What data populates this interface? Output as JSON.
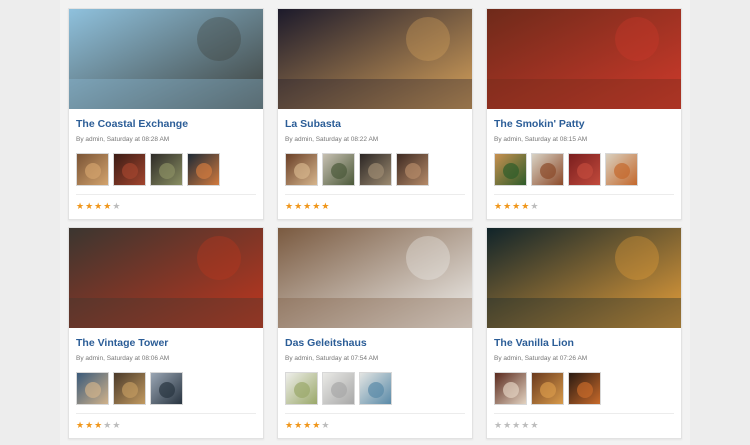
{
  "restaurants": [
    {
      "name": "The Coastal Exchange",
      "meta": "By admin, Saturday at 08:28 AM",
      "rating": 4,
      "hero_colors": [
        "#8fc1dd",
        "#3c3f3a"
      ],
      "thumbs": [
        [
          "#7a5436",
          "#d3a36c"
        ],
        [
          "#3c1c15",
          "#a2452e"
        ],
        [
          "#2e2b28",
          "#8a8f62"
        ],
        [
          "#1d2a36",
          "#d27a3e"
        ]
      ]
    },
    {
      "name": "La Subasta",
      "meta": "By admin, Saturday at 08:22 AM",
      "rating": 5,
      "hero_colors": [
        "#1c1a2b",
        "#d8a35b"
      ],
      "thumbs": [
        [
          "#6a4028",
          "#d6b58c"
        ],
        [
          "#c7c0b2",
          "#4c5a3a"
        ],
        [
          "#2b2624",
          "#9c8a70"
        ],
        [
          "#3e2a22",
          "#b58a68"
        ]
      ]
    },
    {
      "name": "The Smokin' Patty",
      "meta": "By admin, Saturday at 08:15 AM",
      "rating": 4,
      "hero_colors": [
        "#6e2a1a",
        "#cf3a2b"
      ],
      "thumbs": [
        [
          "#c79050",
          "#2e5c2a"
        ],
        [
          "#d8d2c4",
          "#8c4a2a"
        ],
        [
          "#7a1e1e",
          "#c24a3c"
        ],
        [
          "#d9d0bf",
          "#c4682c"
        ]
      ]
    },
    {
      "name": "The Vintage Tower",
      "meta": "By admin, Saturday at 08:06 AM",
      "rating": 3,
      "hero_colors": [
        "#3b3630",
        "#c0361e"
      ],
      "thumbs": [
        [
          "#3a5a7a",
          "#d0b28a"
        ],
        [
          "#4a3a2a",
          "#c29a60"
        ],
        [
          "#9aa6b4",
          "#283440"
        ]
      ]
    },
    {
      "name": "Das Geleitshaus",
      "meta": "By admin, Saturday at 07:54 AM",
      "rating": 4,
      "hero_colors": [
        "#7a5a40",
        "#f1f1ef"
      ],
      "thumbs": [
        [
          "#eeeeea",
          "#9aa86a"
        ],
        [
          "#e9e9e6",
          "#a8a8a8"
        ],
        [
          "#e2e4e2",
          "#5a8aa8"
        ]
      ]
    },
    {
      "name": "The Vanilla Lion",
      "meta": "By admin, Saturday at 07:26 AM",
      "rating": 0,
      "hero_colors": [
        "#10242a",
        "#e8a03a"
      ],
      "thumbs": [
        [
          "#5a2a1e",
          "#e2d2c0"
        ],
        [
          "#6a3a1e",
          "#d89a4a"
        ],
        [
          "#2a1a12",
          "#c86a2a"
        ]
      ]
    }
  ]
}
